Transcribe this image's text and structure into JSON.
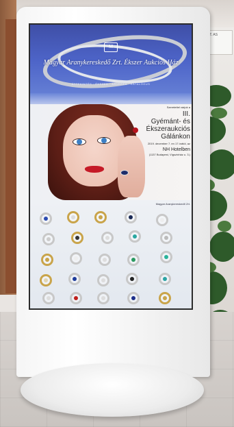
{
  "screen": {
    "banner": {
      "logo_mark": "M",
      "title": "Magyar Aranykereskedő Zrt. Ékszer Aukciós Ház",
      "subtitle": "ÁTTEKINTÉS · ÉKSZER · ÁRVERÉS · KATALÓGUS"
    },
    "event": {
      "intro": "Szeretettel várjuk a",
      "number": "III.",
      "line1": "Gyémánt- és",
      "line2": "Ékszeraukciós",
      "line3": "Gálánkon",
      "date": "2019. december 7. en 17 órától, az",
      "hotel": "NH Hotelben",
      "address": "(1137 Budapest, Vígszínház u. 3.)"
    },
    "jewel_caption": "Magyar Aranykereskedő Zrt."
  },
  "wall_sign": "KFT. AS",
  "colors": {
    "banner_blue": "#4d64c8",
    "lips_red": "#c51a27",
    "eye_blue": "#3d7fc4",
    "kiosk_white": "#f5f5f5"
  }
}
